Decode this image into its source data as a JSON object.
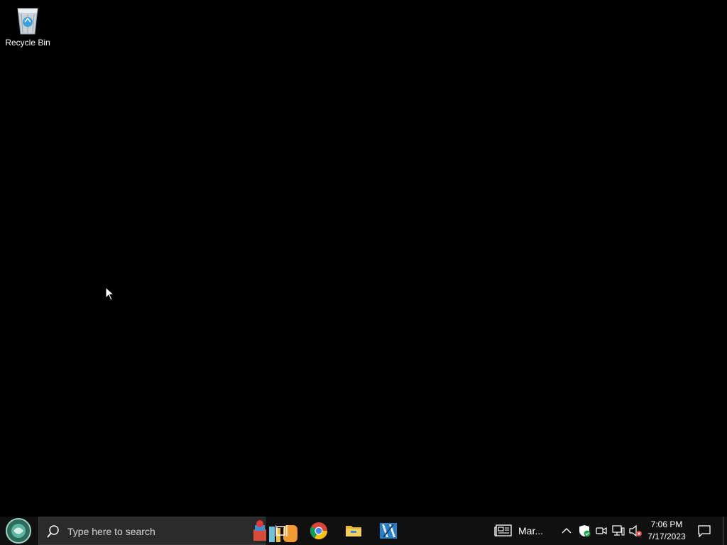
{
  "desktop": {
    "icons": [
      {
        "label": "Recycle Bin",
        "icon": "recycle-bin-icon"
      }
    ]
  },
  "taskbar": {
    "start_icon": "start-orb-icon",
    "search": {
      "placeholder": "Type here to search",
      "icon": "search-icon"
    },
    "pinned": [
      {
        "name": "task-view",
        "icon": "task-view-icon"
      },
      {
        "name": "chrome",
        "icon": "chrome-icon"
      },
      {
        "name": "file-explorer",
        "icon": "folder-icon"
      },
      {
        "name": "app",
        "icon": "app-icon"
      }
    ],
    "news": {
      "label": "Mar...",
      "icon": "news-icon"
    },
    "tray": [
      "chevron-up-icon",
      "defender-shield-icon",
      "meet-now-icon",
      "network-icon",
      "volume-muted-icon"
    ],
    "clock": {
      "time": "7:06 PM",
      "date": "7/17/2023"
    },
    "notification_icon": "notification-icon"
  },
  "colors": {
    "desktop_bg": "#000000",
    "taskbar_bg": "#101010",
    "search_bg": "#2b2b2b"
  }
}
